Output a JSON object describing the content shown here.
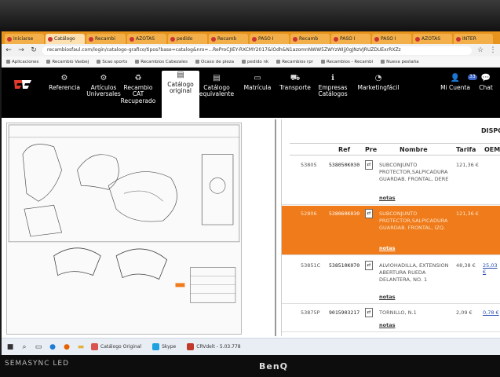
{
  "monitor": {
    "model": "SEMASYNC LED",
    "brand": "BenQ"
  },
  "browser": {
    "tabs": [
      "Iniciarse",
      "Catálogo",
      "Recambi",
      "AZOTAS",
      "pedido",
      "Recamb",
      "PASO I",
      "Recamb",
      "PASO I",
      "PASO I",
      "AZOTAS",
      "INTER"
    ],
    "active_tab": 1,
    "url": "recambiosfaul.com/login/catalogo-grafico/tipos?base=catalog&nro=...ReProCJIEY-RXCMY2017&lOdh&N1azomnNWW5ZWYzWIjj0gJNzVJRUZDUExrRXZz",
    "bookmarks": [
      "Aplicaciones",
      "Recambio Vasbej",
      "Scao sports",
      "Recambios Cabezales",
      "Ocaso de pieza",
      "pedido nk",
      "Recambios rpr",
      "Recambios - Recambi",
      "Nueva pestaña"
    ]
  },
  "nav": {
    "items": [
      {
        "label": "Referencia",
        "icon": "referencia-icon"
      },
      {
        "label": "Artículos Universales",
        "icon": "articulos-icon"
      },
      {
        "label": "Recambio CAT Recuperado",
        "icon": "recycle-icon"
      },
      {
        "label": "Catálogo original",
        "icon": "catalog-icon",
        "active": true
      },
      {
        "label": "Catálogo equivalente",
        "icon": "catalog-eq-icon"
      },
      {
        "label": "Matrícula",
        "icon": "plate-icon"
      },
      {
        "label": "Transporte",
        "icon": "truck-icon"
      },
      {
        "label": "Empresas Catálogos",
        "icon": "info-icon"
      },
      {
        "label": "Marketingfácil",
        "icon": "marketing-icon"
      }
    ],
    "account": {
      "label": "Mi Cuenta",
      "badge": "33"
    },
    "chat": {
      "label": "Chat"
    }
  },
  "table": {
    "header_right": "DISPO",
    "columns": {
      "ref": "Ref",
      "pre": "Pre",
      "name": "Nombre",
      "tarifa": "Tarifa",
      "oem": "OEM"
    },
    "rows": [
      {
        "code": "53805",
        "ref": "538050K030",
        "name": "SUBCONJUNTO PROTECTOR,SALPICADURA GUARDAB. FRONTAL, DERE",
        "notas": "notas",
        "tarifa": "121,36 €",
        "oem": ""
      },
      {
        "code": "52806",
        "ref": "538060K030",
        "name": "SUBCONJUNTO PROTECTOR,SALPICADURA GUARDAB. FRONTAL, IZQ.",
        "notas": "notas",
        "tarifa": "121,36 €",
        "oem": "",
        "highlight": true
      },
      {
        "code": "53851C",
        "ref": "538510K070",
        "name": "ALVIOHADILLA, EXTENSION ABERTURA RUEDA DELANTERA, NO. 1",
        "notas": "notas",
        "tarifa": "48,38 €",
        "oem": "25,03 €"
      },
      {
        "code": "53875P",
        "ref": "9015903217",
        "name": "TORNILLO, N.1",
        "notas": "notas",
        "tarifa": "2,09 €",
        "oem": "0,78 €"
      }
    ]
  },
  "taskbar": {
    "apps": [
      "Catálogo Original",
      "Skype",
      "CRVdelt - 5.03.778"
    ]
  },
  "colors": {
    "accent": "#ef7b1a",
    "nav_bg": "#000000",
    "tab_strip": "#e6941d"
  }
}
